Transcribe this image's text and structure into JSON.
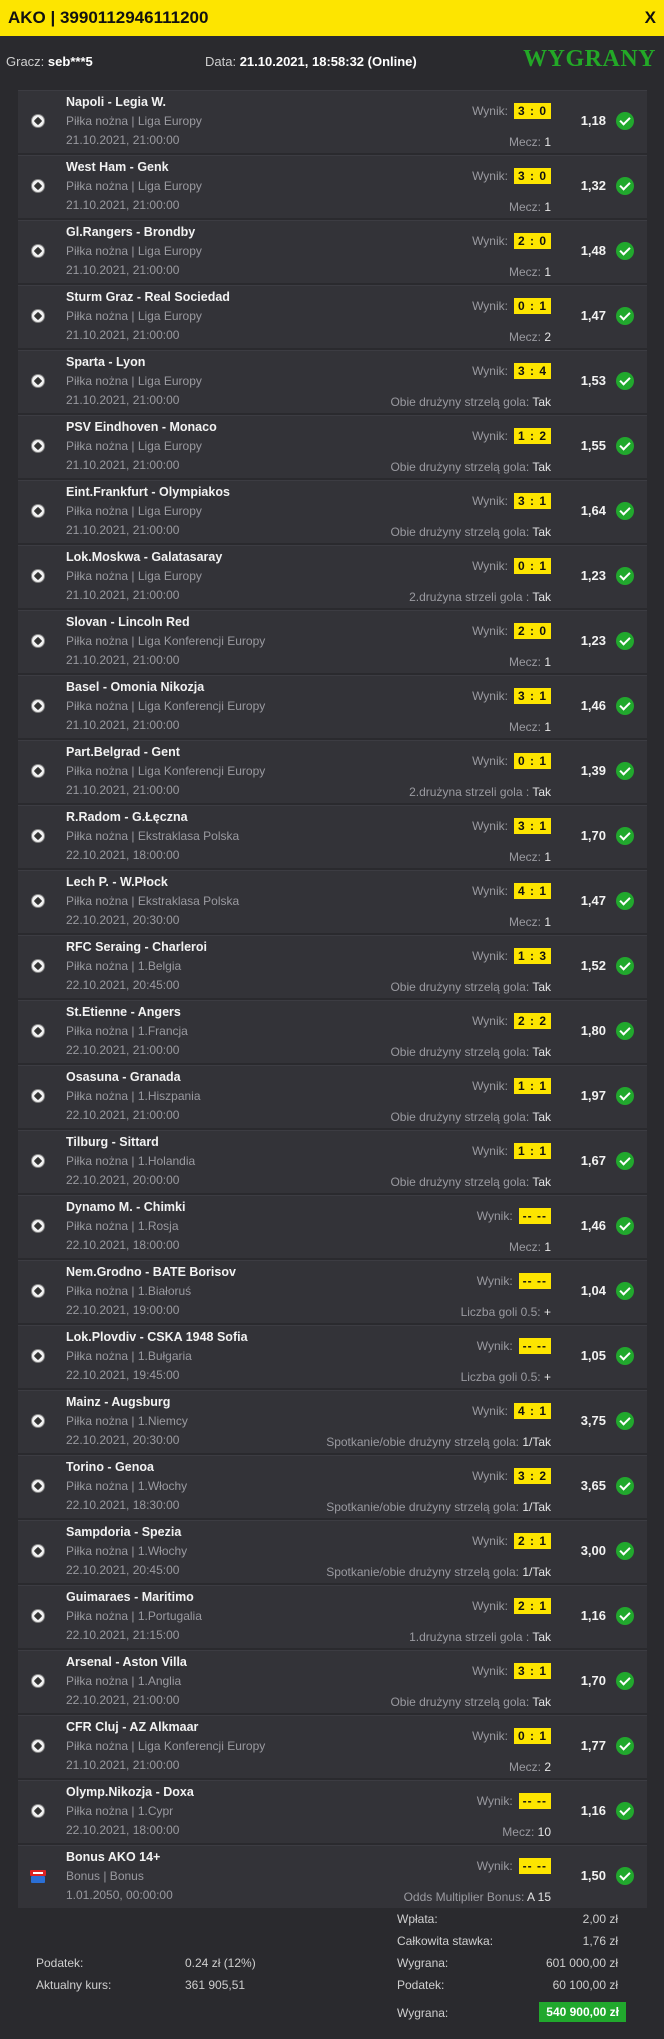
{
  "header": {
    "title": "AKO | 3990112946111200",
    "close": "X"
  },
  "info": {
    "player_label": "Gracz:",
    "player": "seb***5",
    "date_label": "Data:",
    "date": "21.10.2021, 18:58:32 (Online)",
    "status": "WYGRANY"
  },
  "result_label": "Wynik:",
  "events": [
    {
      "match": "Napoli - Legia W.",
      "league": "Piłka nożna | Liga Europy",
      "time": "21.10.2021, 21:00:00",
      "score": "3 : 0",
      "bet_label": "Mecz:",
      "bet_value": "1",
      "odds": "1,18"
    },
    {
      "match": "West Ham - Genk",
      "league": "Piłka nożna | Liga Europy",
      "time": "21.10.2021, 21:00:00",
      "score": "3 : 0",
      "bet_label": "Mecz:",
      "bet_value": "1",
      "odds": "1,32"
    },
    {
      "match": "Gl.Rangers - Brondby",
      "league": "Piłka nożna | Liga Europy",
      "time": "21.10.2021, 21:00:00",
      "score": "2 : 0",
      "bet_label": "Mecz:",
      "bet_value": "1",
      "odds": "1,48"
    },
    {
      "match": "Sturm Graz - Real Sociedad",
      "league": "Piłka nożna | Liga Europy",
      "time": "21.10.2021, 21:00:00",
      "score": "0 : 1",
      "bet_label": "Mecz:",
      "bet_value": "2",
      "odds": "1,47"
    },
    {
      "match": "Sparta - Lyon",
      "league": "Piłka nożna | Liga Europy",
      "time": "21.10.2021, 21:00:00",
      "score": "3 : 4",
      "bet_label": "Obie drużyny strzelą gola:",
      "bet_value": "Tak",
      "odds": "1,53"
    },
    {
      "match": "PSV Eindhoven - Monaco",
      "league": "Piłka nożna | Liga Europy",
      "time": "21.10.2021, 21:00:00",
      "score": "1 : 2",
      "bet_label": "Obie drużyny strzelą gola:",
      "bet_value": "Tak",
      "odds": "1,55"
    },
    {
      "match": "Eint.Frankfurt - Olympiakos",
      "league": "Piłka nożna | Liga Europy",
      "time": "21.10.2021, 21:00:00",
      "score": "3 : 1",
      "bet_label": "Obie drużyny strzelą gola:",
      "bet_value": "Tak",
      "odds": "1,64"
    },
    {
      "match": "Lok.Moskwa - Galatasaray",
      "league": "Piłka nożna | Liga Europy",
      "time": "21.10.2021, 21:00:00",
      "score": "0 : 1",
      "bet_label": "2.drużyna strzeli gola :",
      "bet_value": "Tak",
      "odds": "1,23"
    },
    {
      "match": "Slovan - Lincoln Red",
      "league": "Piłka nożna | Liga Konferencji Europy",
      "time": "21.10.2021, 21:00:00",
      "score": "2 : 0",
      "bet_label": "Mecz:",
      "bet_value": "1",
      "odds": "1,23"
    },
    {
      "match": "Basel - Omonia Nikozja",
      "league": "Piłka nożna | Liga Konferencji Europy",
      "time": "21.10.2021, 21:00:00",
      "score": "3 : 1",
      "bet_label": "Mecz:",
      "bet_value": "1",
      "odds": "1,46"
    },
    {
      "match": "Part.Belgrad - Gent",
      "league": "Piłka nożna | Liga Konferencji Europy",
      "time": "21.10.2021, 21:00:00",
      "score": "0 : 1",
      "bet_label": "2.drużyna strzeli gola :",
      "bet_value": "Tak",
      "odds": "1,39"
    },
    {
      "match": "R.Radom - G.Łęczna",
      "league": "Piłka nożna | Ekstraklasa Polska",
      "time": "22.10.2021, 18:00:00",
      "score": "3 : 1",
      "bet_label": "Mecz:",
      "bet_value": "1",
      "odds": "1,70"
    },
    {
      "match": "Lech P. - W.Płock",
      "league": "Piłka nożna | Ekstraklasa Polska",
      "time": "22.10.2021, 20:30:00",
      "score": "4 : 1",
      "bet_label": "Mecz:",
      "bet_value": "1",
      "odds": "1,47"
    },
    {
      "match": "RFC Seraing - Charleroi",
      "league": "Piłka nożna | 1.Belgia",
      "time": "22.10.2021, 20:45:00",
      "score": "1 : 3",
      "bet_label": "Obie drużyny strzelą gola:",
      "bet_value": "Tak",
      "odds": "1,52"
    },
    {
      "match": "St.Etienne - Angers",
      "league": "Piłka nożna | 1.Francja",
      "time": "22.10.2021, 21:00:00",
      "score": "2 : 2",
      "bet_label": "Obie drużyny strzelą gola:",
      "bet_value": "Tak",
      "odds": "1,80"
    },
    {
      "match": "Osasuna - Granada",
      "league": "Piłka nożna | 1.Hiszpania",
      "time": "22.10.2021, 21:00:00",
      "score": "1 : 1",
      "bet_label": "Obie drużyny strzelą gola:",
      "bet_value": "Tak",
      "odds": "1,97"
    },
    {
      "match": "Tilburg - Sittard",
      "league": "Piłka nożna | 1.Holandia",
      "time": "22.10.2021, 20:00:00",
      "score": "1 : 1",
      "bet_label": "Obie drużyny strzelą gola:",
      "bet_value": "Tak",
      "odds": "1,67"
    },
    {
      "match": "Dynamo M. - Chimki",
      "league": "Piłka nożna | 1.Rosja",
      "time": "22.10.2021, 18:00:00",
      "score": "-- --",
      "bet_label": "Mecz:",
      "bet_value": "1",
      "odds": "1,46"
    },
    {
      "match": "Nem.Grodno - BATE Borisov",
      "league": "Piłka nożna | 1.Białoruś",
      "time": "22.10.2021, 19:00:00",
      "score": "-- --",
      "bet_label": "Liczba goli 0.5:",
      "bet_value": "+",
      "odds": "1,04"
    },
    {
      "match": "Lok.Plovdiv - CSKA 1948 Sofia",
      "league": "Piłka nożna | 1.Bułgaria",
      "time": "22.10.2021, 19:45:00",
      "score": "-- --",
      "bet_label": "Liczba goli 0.5:",
      "bet_value": "+",
      "odds": "1,05"
    },
    {
      "match": "Mainz - Augsburg",
      "league": "Piłka nożna | 1.Niemcy",
      "time": "22.10.2021, 20:30:00",
      "score": "4 : 1",
      "bet_label": "Spotkanie/obie drużyny strzelą gola:",
      "bet_value": "1/Tak",
      "odds": "3,75"
    },
    {
      "match": "Torino - Genoa",
      "league": "Piłka nożna | 1.Włochy",
      "time": "22.10.2021, 18:30:00",
      "score": "3 : 2",
      "bet_label": "Spotkanie/obie drużyny strzelą gola:",
      "bet_value": "1/Tak",
      "odds": "3,65"
    },
    {
      "match": "Sampdoria - Spezia",
      "league": "Piłka nożna | 1.Włochy",
      "time": "22.10.2021, 20:45:00",
      "score": "2 : 1",
      "bet_label": "Spotkanie/obie drużyny strzelą gola:",
      "bet_value": "1/Tak",
      "odds": "3,00"
    },
    {
      "match": "Guimaraes - Maritimo",
      "league": "Piłka nożna | 1.Portugalia",
      "time": "22.10.2021, 21:15:00",
      "score": "2 : 1",
      "bet_label": "1.drużyna strzeli gola :",
      "bet_value": "Tak",
      "odds": "1,16"
    },
    {
      "match": "Arsenal - Aston Villa",
      "league": "Piłka nożna | 1.Anglia",
      "time": "22.10.2021, 21:00:00",
      "score": "3 : 1",
      "bet_label": "Obie drużyny strzelą gola:",
      "bet_value": "Tak",
      "odds": "1,70"
    },
    {
      "match": "CFR Cluj - AZ Alkmaar",
      "league": "Piłka nożna | Liga Konferencji Europy",
      "time": "21.10.2021, 21:00:00",
      "score": "0 : 1",
      "bet_label": "Mecz:",
      "bet_value": "2",
      "odds": "1,77"
    },
    {
      "match": "Olymp.Nikozja - Doxa",
      "league": "Piłka nożna | 1.Cypr",
      "time": "22.10.2021, 18:00:00",
      "score": "-- --",
      "bet_label": "Mecz:",
      "bet_value": "10",
      "odds": "1,16"
    },
    {
      "match": "Bonus AKO 14+",
      "league": "Bonus | Bonus",
      "time": "1.01.2050, 00:00:00",
      "score": "-- --",
      "bet_label": "Odds Multiplier Bonus:",
      "bet_value": "A 15",
      "odds": "1,50",
      "bonus": true
    }
  ],
  "summary": {
    "tax_label": "Podatek:",
    "tax_value": "0.24 zł (12%)",
    "rate_label": "Aktualny kurs:",
    "rate_value": "361 905,51",
    "deposit_label": "Wpłata:",
    "deposit_value": "2,00 zł",
    "stake_label": "Całkowita stawka:",
    "stake_value": "1,76 zł",
    "gross_win_label": "Wygrana:",
    "gross_win_value": "601 000,00 zł",
    "win_tax_label": "Podatek:",
    "win_tax_value": "60 100,00 zł",
    "net_win_label": "Wygrana:",
    "net_win_value": "540 900,00 zł"
  }
}
